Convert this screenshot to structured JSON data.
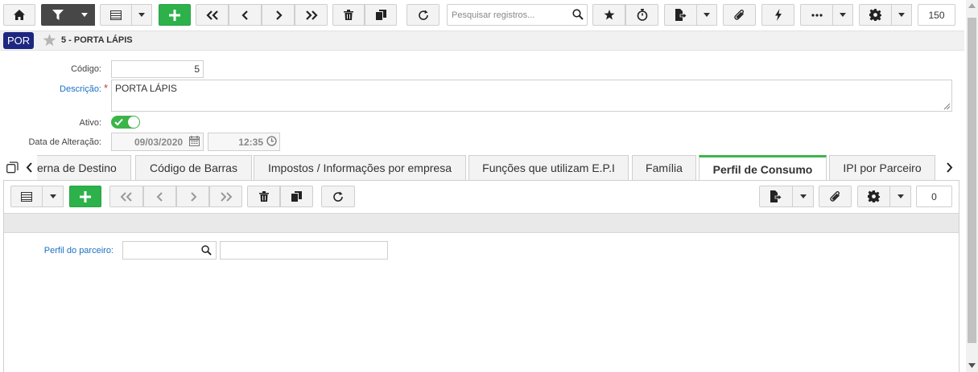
{
  "toolbar": {
    "search_placeholder": "Pesquisar registros...",
    "page_size": "150"
  },
  "record": {
    "badge": "POR",
    "title": "5 - PORTA LÁPIS"
  },
  "form": {
    "codigo_label": "Código:",
    "codigo_value": "5",
    "descricao_label": "Descrição:",
    "required_mark": "*",
    "descricao_value": "PORTA LÁPIS",
    "ativo_label": "Ativo:",
    "ativo_on": true,
    "data_label": "Data de Alteração:",
    "data_value": "09/03/2020",
    "hora_value": "12:35"
  },
  "tabs": [
    {
      "label": "erna de Destino"
    },
    {
      "label": "Código de Barras"
    },
    {
      "label": "Impostos / Informações por empresa"
    },
    {
      "label": "Funções que utilizam E.P.I"
    },
    {
      "label": "Família"
    },
    {
      "label": "Perfil de Consumo",
      "active": true
    },
    {
      "label": "IPI por Parceiro"
    }
  ],
  "subtoolbar": {
    "count": "0"
  },
  "perfil": {
    "label": "Perfil do parceiro:",
    "code_value": "",
    "name_value": ""
  },
  "colors": {
    "accent_green": "#2db14a",
    "link_blue": "#1a6fc4",
    "badge_navy": "#1d2680",
    "toggle_green": "#3bb54a"
  }
}
